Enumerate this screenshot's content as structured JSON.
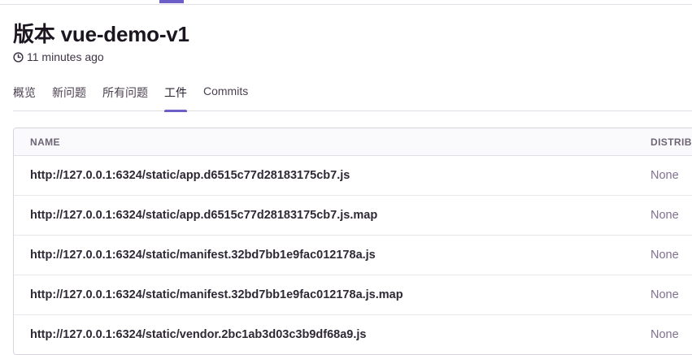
{
  "release": {
    "title": "版本 vue-demo-v1",
    "time_ago": "11 minutes ago"
  },
  "icons": {
    "clock": "clock-icon"
  },
  "colors": {
    "accent": "#6c5fc7",
    "border": "#e2dee6"
  },
  "tabs": [
    {
      "label": "概览",
      "active": false
    },
    {
      "label": "新问题",
      "active": false
    },
    {
      "label": "所有问题",
      "active": false
    },
    {
      "label": "工件",
      "active": true
    },
    {
      "label": "Commits",
      "active": false
    }
  ],
  "table": {
    "columns": [
      "NAME",
      "DISTRIBU"
    ],
    "rows": [
      {
        "name": "http://127.0.0.1:6324/static/app.d6515c77d28183175cb7.js",
        "distribution": "None"
      },
      {
        "name": "http://127.0.0.1:6324/static/app.d6515c77d28183175cb7.js.map",
        "distribution": "None"
      },
      {
        "name": "http://127.0.0.1:6324/static/manifest.32bd7bb1e9fac012178a.js",
        "distribution": "None"
      },
      {
        "name": "http://127.0.0.1:6324/static/manifest.32bd7bb1e9fac012178a.js.map",
        "distribution": "None"
      },
      {
        "name": "http://127.0.0.1:6324/static/vendor.2bc1ab3d03c3b9df68a9.js",
        "distribution": "None"
      }
    ]
  }
}
